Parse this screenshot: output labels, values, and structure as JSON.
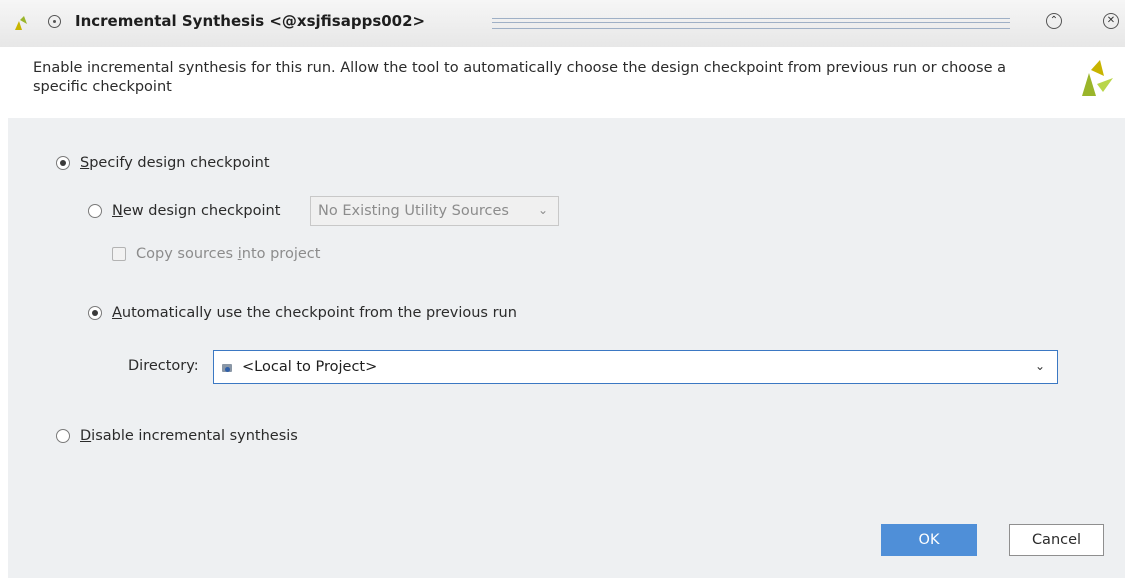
{
  "window": {
    "title": "Incremental Synthesis <@xsjfisapps002>"
  },
  "header": {
    "description": "Enable incremental synthesis for this run. Allow the tool to automatically choose the design checkpoint from previous run or choose a specific checkpoint"
  },
  "options": {
    "specify": {
      "accel": "S",
      "rest": "pecify design checkpoint",
      "selected": true
    },
    "new_checkpoint": {
      "accel": "N",
      "rest": "ew design checkpoint",
      "selected": false
    },
    "new_checkpoint_combo": {
      "value": "No Existing Utility Sources",
      "enabled": false
    },
    "copy_sources": {
      "before": "Copy sources ",
      "accel": "i",
      "after": "nto project",
      "checked": false,
      "enabled": false
    },
    "auto_checkpoint": {
      "accel": "A",
      "rest": "utomatically use the checkpoint from the previous run",
      "selected": true
    },
    "directory": {
      "label": "Directory:",
      "value": "<Local to Project>"
    },
    "disable": {
      "accel": "D",
      "rest": "isable incremental synthesis",
      "selected": false
    }
  },
  "buttons": {
    "ok": "OK",
    "cancel": "Cancel"
  },
  "colors": {
    "accent": "#4f8fd8",
    "focus_border": "#3b78c3",
    "logo_yellow": "#c8b400",
    "logo_green": "#7a9a1e"
  }
}
